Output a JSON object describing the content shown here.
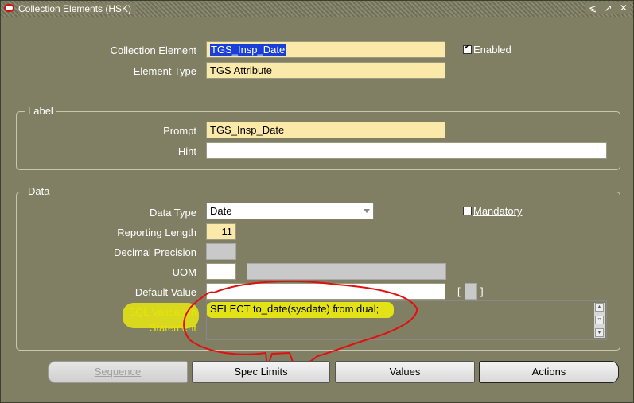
{
  "window": {
    "title": "Collection Elements (HSK)",
    "controls": "⩽ ↗ ✕"
  },
  "header": {
    "collection_element_label": "Collection Element",
    "collection_element_value": "TGS_Insp_Date",
    "element_type_label": "Element Type",
    "element_type_value": "TGS Attribute",
    "enabled_label": "Enabled",
    "enabled_checked": true
  },
  "label_group": {
    "title": "Label",
    "prompt_label": "Prompt",
    "prompt_value": "TGS_Insp_Date",
    "hint_label": "Hint",
    "hint_value": ""
  },
  "data_group": {
    "title": "Data",
    "data_type_label": "Data Type",
    "data_type_value": "Date",
    "mandatory_label": "Mandatory",
    "mandatory_checked": false,
    "reporting_length_label": "Reporting Length",
    "reporting_length_value": "11",
    "decimal_precision_label": "Decimal Precision",
    "decimal_precision_value": "",
    "uom_label": "UOM",
    "uom_value": "",
    "uom_desc_value": "",
    "default_value_label": "Default Value",
    "default_value_value": "",
    "bracket_open": "[",
    "bracket_close": "]",
    "sql_validation_label_line1": "SQL Validation",
    "sql_validation_label_line2": "Statement",
    "sql_validation_value": "SELECT to_date(sysdate) from dual;"
  },
  "buttons": {
    "sequence": "Sequence",
    "spec_limits": "Spec Limits",
    "values": "Values",
    "actions": "Actions"
  },
  "colors": {
    "window_bg": "#807f63",
    "required_field": "#fbe9aa",
    "selection": "#1a3fd6",
    "annotation_highlight": "#e8e812",
    "annotation_ink": "#e01010"
  }
}
